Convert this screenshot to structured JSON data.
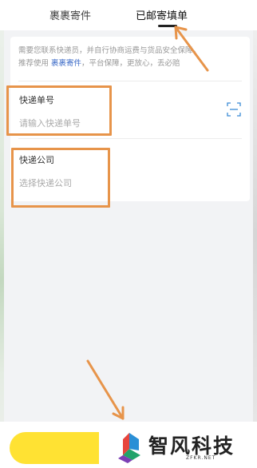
{
  "tabs": [
    {
      "label": "裹裹寄件"
    },
    {
      "label": "已邮寄填单"
    }
  ],
  "notice": {
    "line1": "需要您联系快递员，并自行协商运费与货品安全保障。",
    "line2_prefix": "推荐使用 ",
    "line2_link": "裹裹寄件",
    "line2_suffix": "，平台保障，更放心，丢必赔"
  },
  "tracking": {
    "label": "快递单号",
    "placeholder": "请输入快递单号",
    "scan_icon": "scan-icon"
  },
  "courier": {
    "label": "快递公司",
    "placeholder": "选择快递公司"
  },
  "watermark": {
    "name": "智风科技",
    "domain": "ZFKR.NET"
  },
  "colors": {
    "highlight": "#e7944a",
    "link": "#3b6ac7",
    "button": "#ffe233"
  }
}
